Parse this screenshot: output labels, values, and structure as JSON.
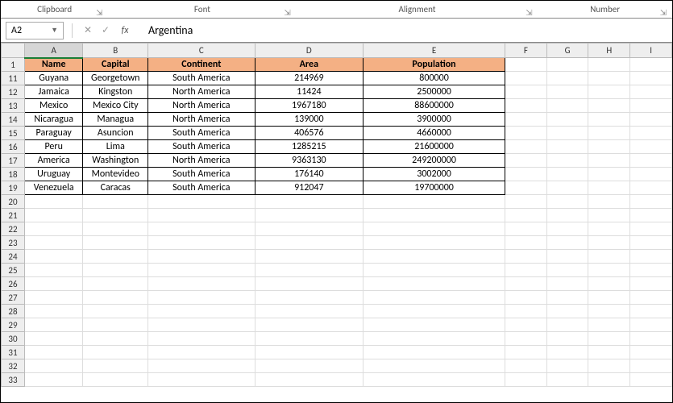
{
  "ribbon": {
    "groups": [
      "Clipboard",
      "Font",
      "Alignment",
      "Number"
    ]
  },
  "formula_bar": {
    "name_box": "A2",
    "fx_label": "fx",
    "formula_value": "Argentina"
  },
  "columns": [
    "A",
    "B",
    "C",
    "D",
    "E",
    "F",
    "G",
    "H",
    "I"
  ],
  "selected_column": "A",
  "visible_row_numbers": [
    1,
    11,
    12,
    13,
    14,
    15,
    16,
    17,
    18,
    19,
    20,
    21,
    22,
    23,
    24,
    25,
    26,
    27,
    28,
    29,
    30,
    31,
    32,
    33
  ],
  "header_row_number": 1,
  "headers": [
    "Name",
    "Capital",
    "Continent",
    "Area",
    "Population"
  ],
  "data_rows": [
    {
      "row": 11,
      "cells": [
        "Guyana",
        "Georgetown",
        "South America",
        "214969",
        "800000"
      ]
    },
    {
      "row": 12,
      "cells": [
        "Jamaica",
        "Kingston",
        "North America",
        "11424",
        "2500000"
      ]
    },
    {
      "row": 13,
      "cells": [
        "Mexico",
        "Mexico City",
        "North America",
        "1967180",
        "88600000"
      ]
    },
    {
      "row": 14,
      "cells": [
        "Nicaragua",
        "Managua",
        "North America",
        "139000",
        "3900000"
      ]
    },
    {
      "row": 15,
      "cells": [
        "Paraguay",
        "Asuncion",
        "South America",
        "406576",
        "4660000"
      ]
    },
    {
      "row": 16,
      "cells": [
        "Peru",
        "Lima",
        "South America",
        "1285215",
        "21600000"
      ]
    },
    {
      "row": 17,
      "cells": [
        "America",
        "Washington",
        "North America",
        "9363130",
        "249200000"
      ]
    },
    {
      "row": 18,
      "cells": [
        "Uruguay",
        "Montevideo",
        "South America",
        "176140",
        "3002000"
      ]
    },
    {
      "row": 19,
      "cells": [
        "Venezuela",
        "Caracas",
        "South America",
        "912047",
        "19700000"
      ]
    }
  ],
  "colors": {
    "header_fill": "#f4b084"
  }
}
